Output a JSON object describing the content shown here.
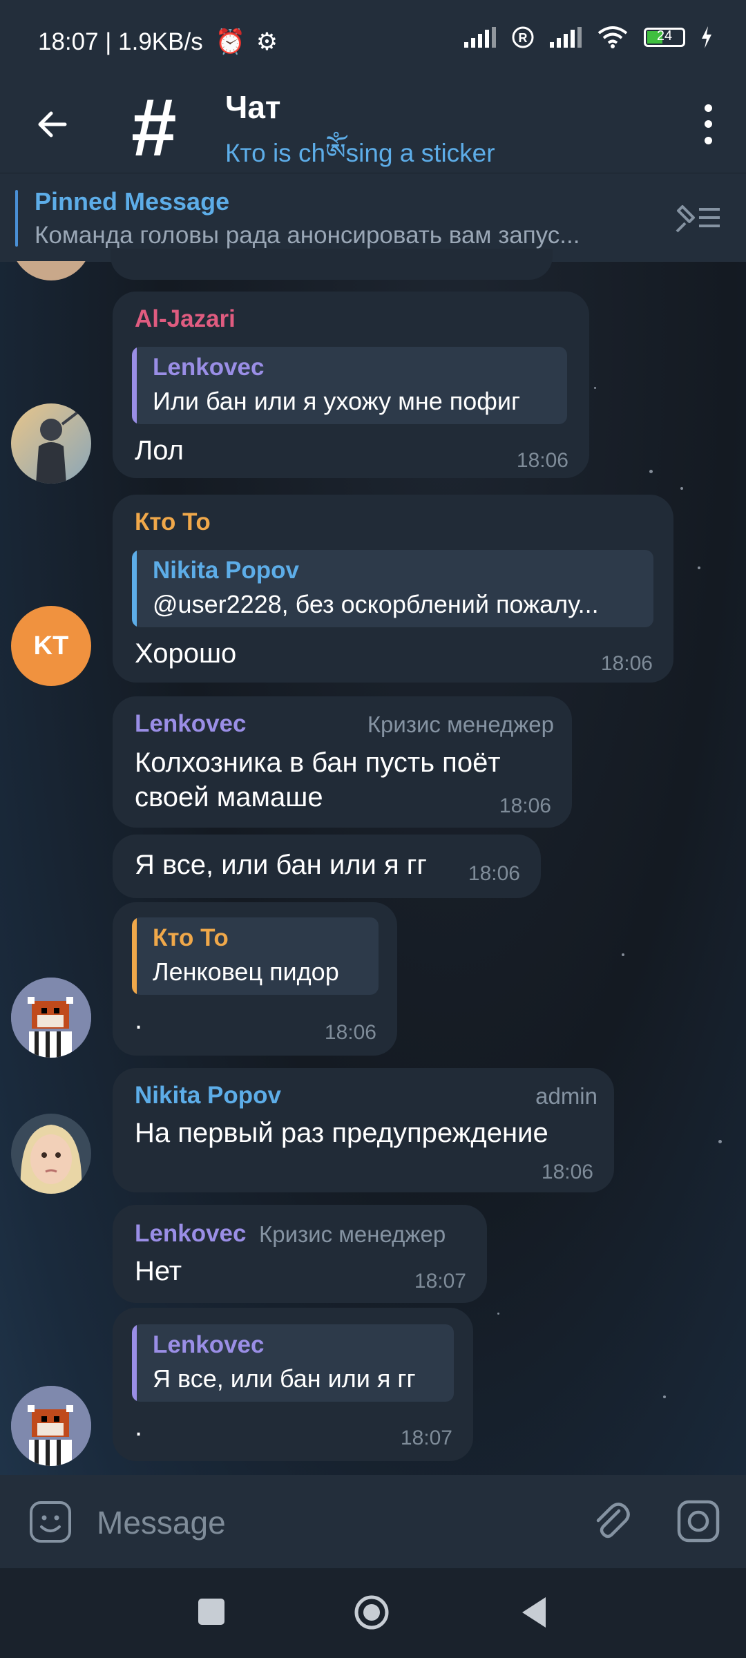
{
  "status_bar": {
    "time_speed": "18:07 | 1.9KB/s",
    "battery": "24"
  },
  "header": {
    "title": "Чат",
    "subtitle": "Кто is chༀsing a sticker"
  },
  "pinned": {
    "title": "Pinned Message",
    "text": "Команда головы рада анонсировать вам запус..."
  },
  "messages": [
    {
      "sender": "Al-Jazari",
      "sender_color": "#e05c80",
      "reply_name": "Lenkovec",
      "reply_text": "Или бан или я ухожу мне пофиг",
      "reply_color": "#9a8ee6",
      "text": "Лол",
      "time": "18:06"
    },
    {
      "sender": "Кто То",
      "sender_color": "#f0a84a",
      "reply_name": "Nikita Popov",
      "reply_text": "@user2228, без оскорблений пожалу...",
      "reply_color": "#5dade8",
      "text": "Хорошо",
      "time": "18:06",
      "avatar_initials": "KT"
    },
    {
      "sender": "Lenkovec",
      "sender_color": "#9a8ee6",
      "rank": "Кризис менеджер",
      "text_line1": "Колхозника в бан пусть поёт",
      "text_line2": "своей мамаше",
      "time": "18:06"
    },
    {
      "text": "Я все, или бан или я гг",
      "time": "18:06"
    },
    {
      "reply_name": "Кто То",
      "reply_text": "Ленковец пидор",
      "reply_color": "#f0a84a",
      "text": ".",
      "time": "18:06"
    },
    {
      "sender": "Nikita Popov",
      "sender_color": "#5dade8",
      "rank": "admin",
      "text": "На первый раз предупреждение",
      "time": "18:06"
    },
    {
      "sender": "Lenkovec",
      "sender_color": "#9a8ee6",
      "rank": "Кризис менеджер",
      "text": "Нет",
      "time": "18:07"
    },
    {
      "reply_name": "Lenkovec",
      "reply_text": "Я все, или бан или я гг",
      "reply_color": "#9a8ee6",
      "text": ".",
      "time": "18:07"
    }
  ],
  "input": {
    "placeholder": "Message"
  },
  "icons": [
    "back-arrow-icon",
    "menu-dots-icon",
    "unpin-list-icon",
    "emoji-icon",
    "attach-icon",
    "camera-icon",
    "nav-recents-icon",
    "nav-home-icon",
    "nav-back-icon"
  ]
}
